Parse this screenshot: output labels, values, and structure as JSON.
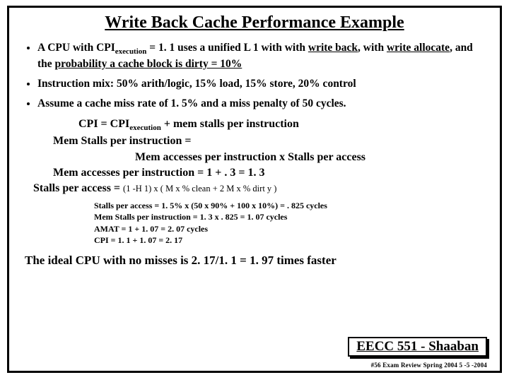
{
  "title": "Write Back Cache Performance Example",
  "bullets": {
    "b1_pre": "A CPU with  CPI",
    "b1_sub": "execution",
    "b1_mid": "  =  1. 1 uses a unified L 1 with with ",
    "b1_u1": "write back",
    "b1_mid2": ", with ",
    "b1_u2": "write allocate",
    "b1_mid3": ", and the ",
    "b1_u3": "probability a cache block is dirty = 10%",
    "b2": "Instruction mix:   50% arith/logic,  15% load, 15% store, 20% control",
    "b3": "Assume a cache miss rate of 1. 5% and a miss penalty of 50 cycles."
  },
  "formulas": {
    "f1_pre": "CPI =   CPI",
    "f1_sub": "execution",
    "f1_post": "   +   mem stalls per instruction",
    "f2": "Mem Stalls per instruction = ",
    "f3": "Mem accesses per instruction  x  Stalls per access",
    "f4": "Mem accesses per instruction  =  1  +  . 3   =  1. 3",
    "f5_big": "Stalls per access =  ",
    "f5_sm": "(1 -H 1)  x  ( M x  % clean   +  2 M x   % dirt y )"
  },
  "micro": {
    "m1": "Stalls per access  = 1. 5%  x  (50  x  90% +   100 x 10%)  =  . 825  cycles",
    "m2": "Mem Stalls per instruction  =  1. 3  x  . 825  =  1. 07 cycles",
    "m3": "AMAT  =  1  +  1. 07 =  2. 07  cycles",
    "m4": "CPI =  1. 1  + 1. 07  =   2. 17"
  },
  "conclusion": "The ideal CPU with no misses is  2. 17/1. 1 =  1. 97  times faster",
  "footer": {
    "course": "EECC 551 - Shaaban",
    "note": "#56   Exam Review  Spring 2004  5 -5 -2004"
  }
}
